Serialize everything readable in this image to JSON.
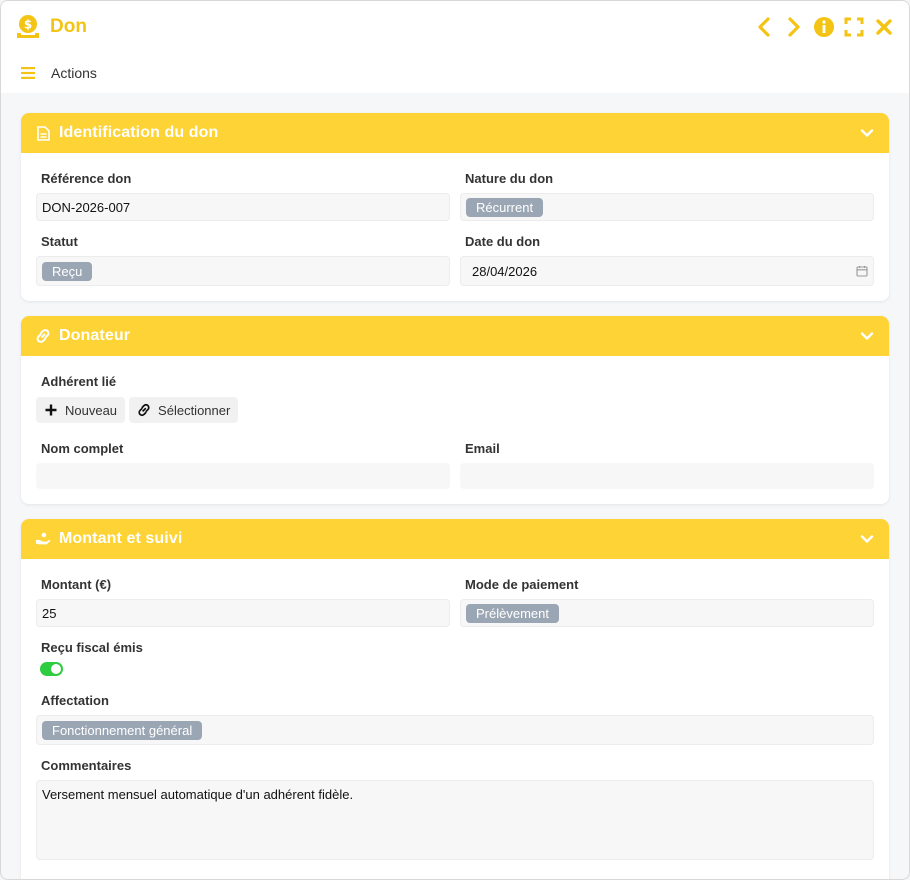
{
  "window": {
    "title": "Don"
  },
  "menubar": {
    "actions_label": "Actions"
  },
  "sections": {
    "identification": {
      "title": "Identification du don",
      "reference_label": "Référence don",
      "reference_value": "DON-2026-007",
      "nature_label": "Nature du don",
      "nature_value": "Récurrent",
      "statut_label": "Statut",
      "statut_value": "Reçu",
      "date_label": "Date du don",
      "date_value": "28/04/2026"
    },
    "donateur": {
      "title": "Donateur",
      "adherent_label": "Adhérent lié",
      "nouveau_label": "Nouveau",
      "selectionner_label": "Sélectionner",
      "nom_label": "Nom complet",
      "nom_value": "",
      "email_label": "Email",
      "email_value": ""
    },
    "montant": {
      "title": "Montant et suivi",
      "montant_label": "Montant (€)",
      "montant_value": "25",
      "mode_label": "Mode de paiement",
      "mode_value": "Prélèvement",
      "recu_label": "Reçu fiscal émis",
      "recu_value": true,
      "affectation_label": "Affectation",
      "affectation_value": "Fonctionnement général",
      "commentaires_label": "Commentaires",
      "commentaires_value": "Versement mensuel automatique d'un adhérent fidèle."
    }
  },
  "colors": {
    "accent": "#fdd335",
    "title": "#f3c414",
    "chip": "#9ba6b4",
    "toggle_on": "#2ecc40"
  },
  "icons": [
    "money-bag-icon",
    "chevron-left-icon",
    "chevron-right-icon",
    "info-icon",
    "fullscreen-icon",
    "close-icon",
    "hamburger-icon",
    "document-icon",
    "link-icon",
    "hand-coin-icon",
    "chevron-down-icon",
    "calendar-icon",
    "plus-icon"
  ]
}
